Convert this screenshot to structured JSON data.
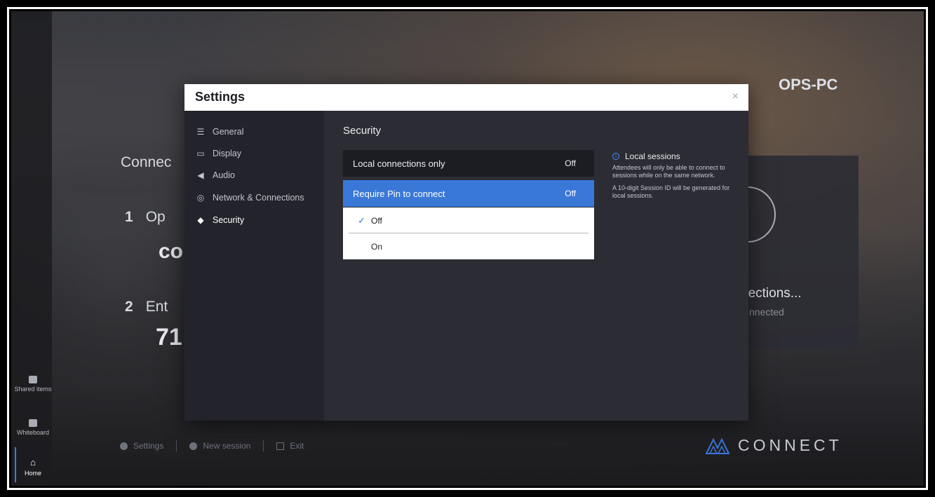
{
  "background": {
    "device_name": "OPS-PC",
    "connect_heading": "Connec",
    "step1_number": "1",
    "step1_text": "Op",
    "step1_code": "co",
    "step2_number": "2",
    "step2_text": "Ent",
    "step2_code": "71",
    "status_text": "nections...",
    "status_sub": "nnected",
    "bottom_bar": {
      "settings_label": "Settings",
      "new_session_label": "New session",
      "exit_label": "Exit"
    },
    "brand_name": "CONNECT"
  },
  "rail": {
    "items": [
      {
        "label": "Shared items",
        "icon": "shared-items-icon"
      },
      {
        "label": "Whiteboard",
        "icon": "whiteboard-icon"
      },
      {
        "label": "Home",
        "icon": "home-icon"
      }
    ]
  },
  "settings": {
    "title": "Settings",
    "close_glyph": "×",
    "nav": [
      {
        "label": "General",
        "icon": "list-icon"
      },
      {
        "label": "Display",
        "icon": "monitor-icon"
      },
      {
        "label": "Audio",
        "icon": "speaker-icon"
      },
      {
        "label": "Network & Connections",
        "icon": "network-icon"
      },
      {
        "label": "Security",
        "icon": "shield-icon",
        "active": true
      }
    ],
    "section_title": "Security",
    "rows": [
      {
        "label": "Local connections only",
        "value": "Off"
      },
      {
        "label": "Require Pin to connect",
        "value": "Off"
      }
    ],
    "dropdown": {
      "options": [
        "Off",
        "On"
      ],
      "selected": "Off"
    },
    "info": {
      "title": "Local sessions",
      "text1": "Attendees will only be able to connect to sessions while on the same network.",
      "text2": "A 10-digit Session ID will be generated for local sessions."
    }
  },
  "colors": {
    "accent": "#3a78d8",
    "modal_bg": "#2b2c34",
    "sidebar_bg": "#23242b"
  }
}
